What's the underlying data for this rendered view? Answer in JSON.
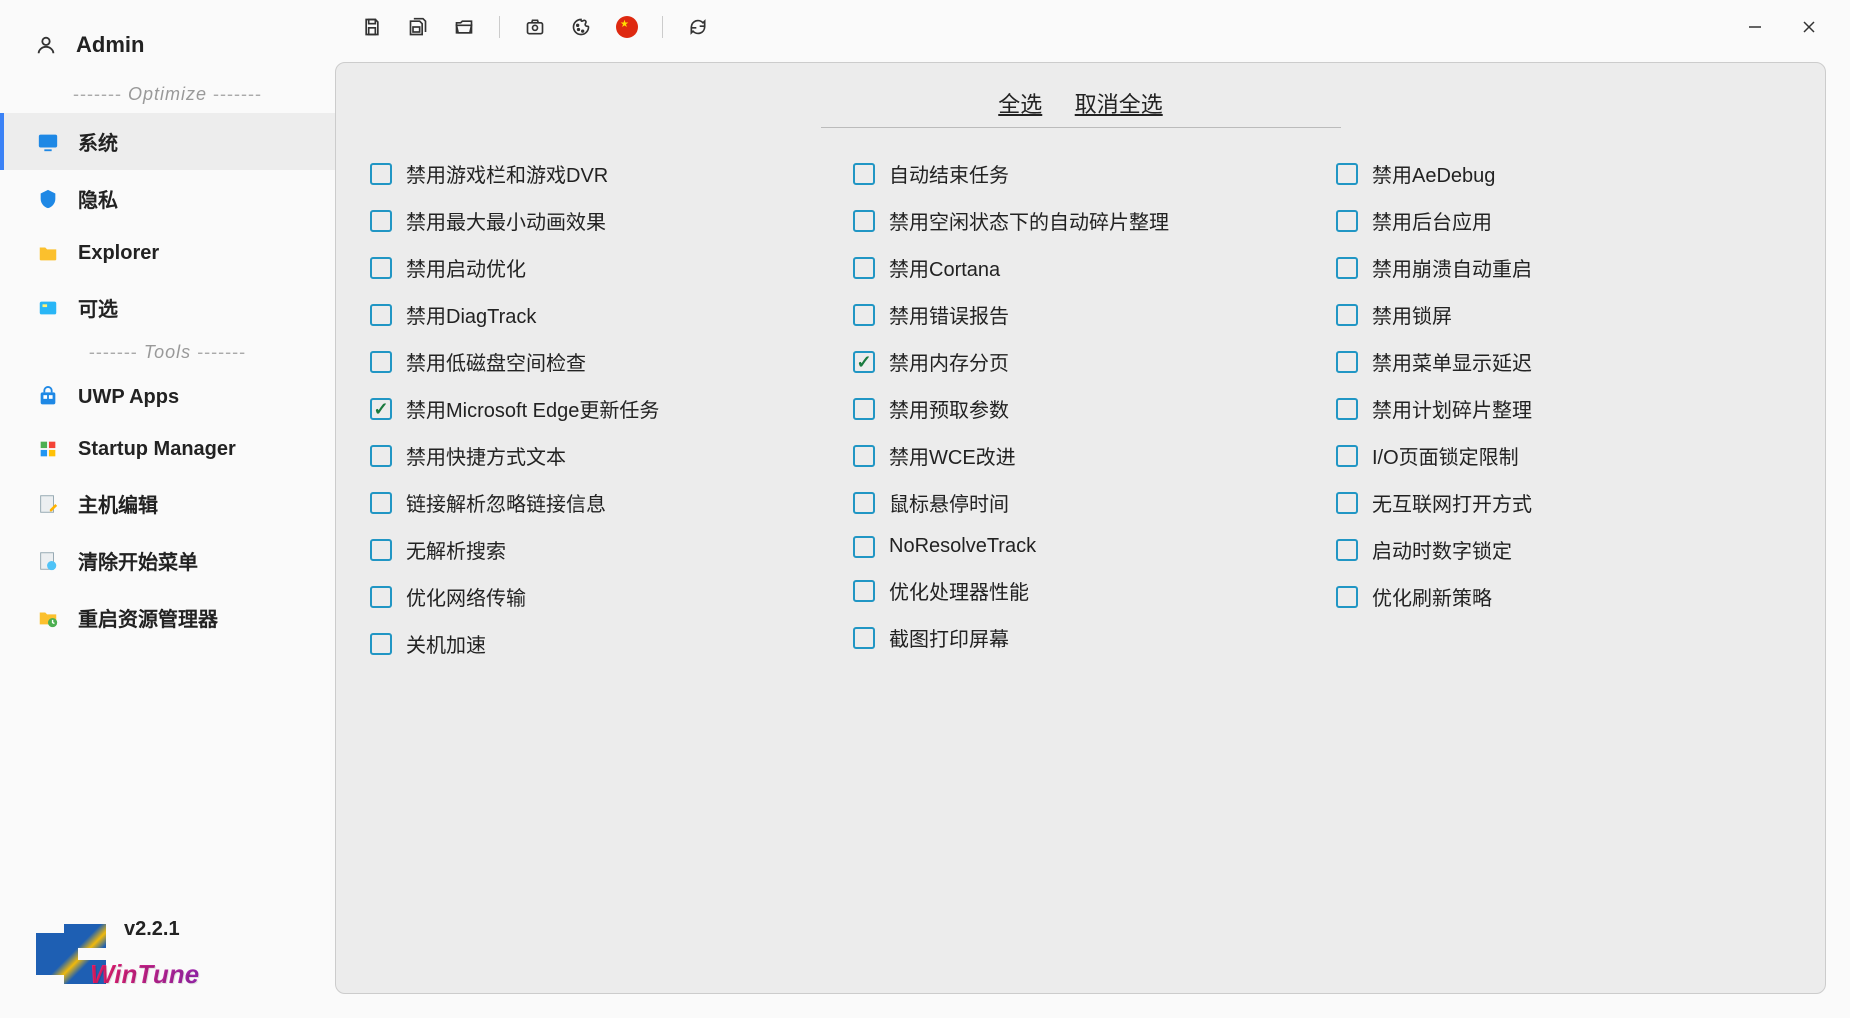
{
  "user": {
    "name": "Admin"
  },
  "sections": {
    "optimize_label": "Optimize",
    "tools_label": "Tools"
  },
  "nav": {
    "system": "系统",
    "privacy": "隐私",
    "explorer": "Explorer",
    "optional": "可选",
    "uwp": "UWP Apps",
    "startup": "Startup Manager",
    "hosts": "主机编辑",
    "clearstart": "清除开始菜单",
    "restartexp": "重启资源管理器"
  },
  "logo": {
    "version": "v2.2.1",
    "name": "WinTune"
  },
  "panel": {
    "select_all": "全选",
    "deselect_all": "取消全选"
  },
  "options": {
    "col1": [
      {
        "label": "禁用游戏栏和游戏DVR",
        "checked": false
      },
      {
        "label": "禁用最大最小动画效果",
        "checked": false
      },
      {
        "label": "禁用启动优化",
        "checked": false
      },
      {
        "label": "禁用DiagTrack",
        "checked": false
      },
      {
        "label": "禁用低磁盘空间检查",
        "checked": false
      },
      {
        "label": "禁用Microsoft Edge更新任务",
        "checked": true
      },
      {
        "label": "禁用快捷方式文本",
        "checked": false
      },
      {
        "label": "链接解析忽略链接信息",
        "checked": false
      },
      {
        "label": "无解析搜索",
        "checked": false
      },
      {
        "label": "优化网络传输",
        "checked": false
      },
      {
        "label": "关机加速",
        "checked": false
      }
    ],
    "col2": [
      {
        "label": "自动结束任务",
        "checked": false
      },
      {
        "label": "禁用空闲状态下的自动碎片整理",
        "checked": false
      },
      {
        "label": "禁用Cortana",
        "checked": false
      },
      {
        "label": "禁用错误报告",
        "checked": false
      },
      {
        "label": "禁用内存分页",
        "checked": true
      },
      {
        "label": "禁用预取参数",
        "checked": false
      },
      {
        "label": "禁用WCE改进",
        "checked": false
      },
      {
        "label": "鼠标悬停时间",
        "checked": false
      },
      {
        "label": "NoResolveTrack",
        "checked": false
      },
      {
        "label": "优化处理器性能",
        "checked": false
      },
      {
        "label": "截图打印屏幕",
        "checked": false
      }
    ],
    "col3": [
      {
        "label": "禁用AeDebug",
        "checked": false
      },
      {
        "label": "禁用后台应用",
        "checked": false
      },
      {
        "label": "禁用崩溃自动重启",
        "checked": false
      },
      {
        "label": "禁用锁屏",
        "checked": false
      },
      {
        "label": "禁用菜单显示延迟",
        "checked": false
      },
      {
        "label": "禁用计划碎片整理",
        "checked": false
      },
      {
        "label": "I/O页面锁定限制",
        "checked": false
      },
      {
        "label": "无互联网打开方式",
        "checked": false
      },
      {
        "label": "启动时数字锁定",
        "checked": false
      },
      {
        "label": "优化刷新策略",
        "checked": false
      }
    ]
  }
}
